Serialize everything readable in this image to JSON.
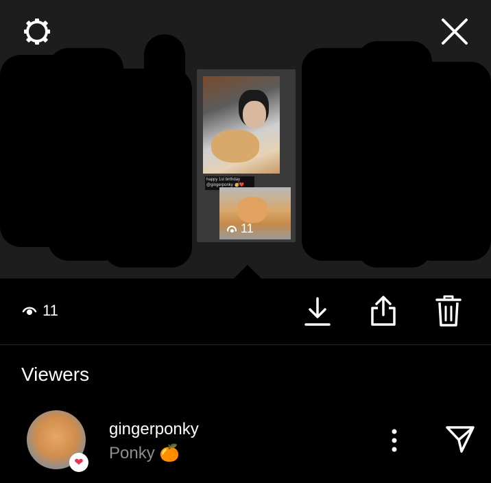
{
  "story": {
    "caption": "happy 1st birthday @gingerponky 🥳❤️",
    "thumb_views": "11"
  },
  "toolbar": {
    "views": "11"
  },
  "viewers": {
    "title": "Viewers",
    "items": [
      {
        "username": "gingerponky",
        "full_name": "Ponky 🍊",
        "reaction": "❤"
      }
    ]
  },
  "icons": {
    "settings": "gear-icon",
    "close": "close-icon",
    "eye": "eye-icon",
    "download": "download-icon",
    "share": "share-icon",
    "delete": "trash-icon",
    "more": "more-vertical-icon",
    "send": "send-icon"
  }
}
